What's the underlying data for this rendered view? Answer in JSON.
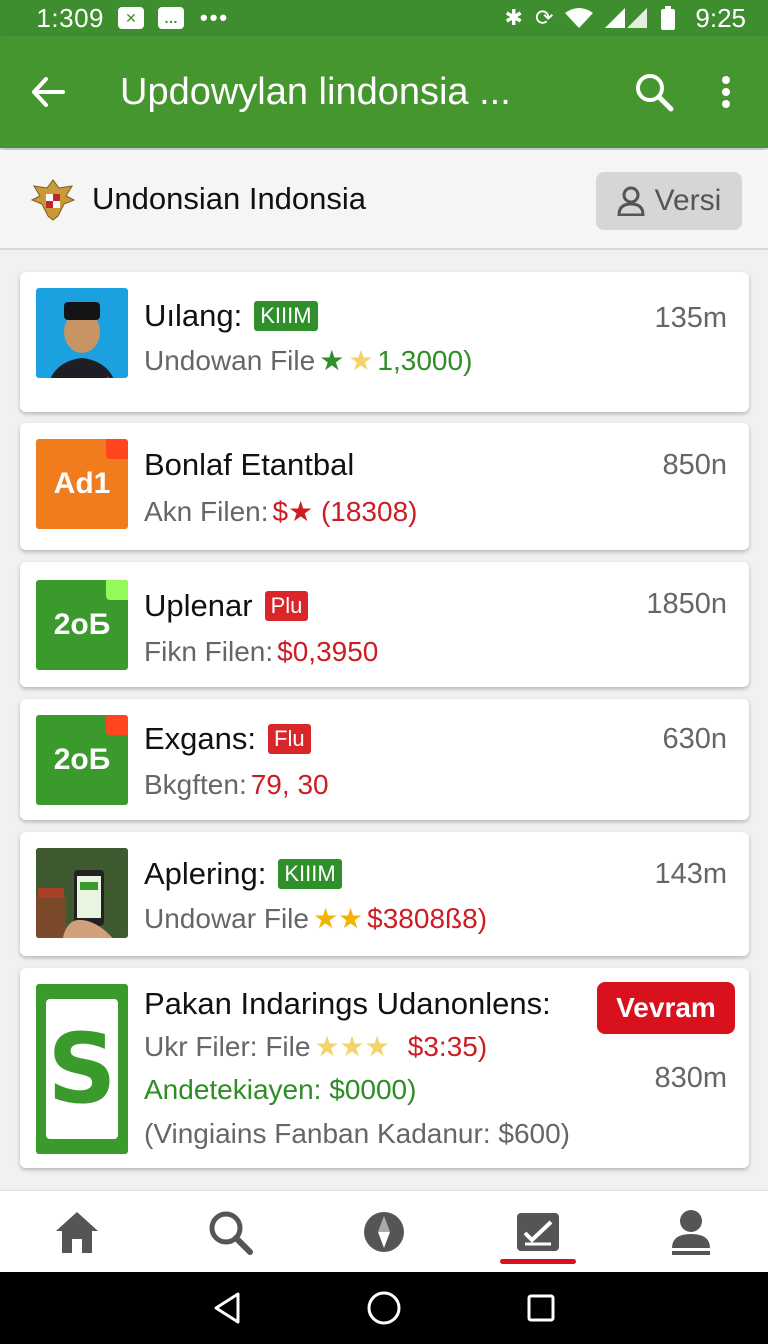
{
  "status_bar": {
    "time": "1:309",
    "clock": "9:25"
  },
  "app_bar": {
    "title": "Updowylan lindonsia ...",
    "back_icon": "arrow-left-icon",
    "search_icon": "search-icon",
    "more_icon": "more-vertical-icon"
  },
  "sub_header": {
    "title": "Undonsian Indonsia",
    "button_label": "Versi"
  },
  "items": [
    {
      "name": "Uılang:",
      "badge": "KIIIM",
      "detail_prefix": "Undowan File",
      "detail_value": "1,3000)",
      "size": "135m"
    },
    {
      "name": "Bonlaf Etantbal",
      "tile_text": "Ad1",
      "detail_prefix": "Akn Filen:",
      "detail_value": "$★ (18308)",
      "size": "850n"
    },
    {
      "name": "Uplenar",
      "badge": "Plu",
      "tile_text": "2oБ",
      "detail_prefix": "Fikn Filen:",
      "detail_value": "$0,3950",
      "size": "1850n"
    },
    {
      "name": "Exgans:",
      "badge": "Flu",
      "tile_text": "2oБ",
      "detail_prefix": "Bkgften:",
      "detail_value": "79, 30",
      "size": "630n"
    },
    {
      "name": "Aplering:",
      "badge": "KIIIM",
      "detail_prefix": "Undowar File",
      "detail_value": "$3808ß8)",
      "size": "143m"
    },
    {
      "name": "Pakan Indarings Udanonlens:",
      "tile_text": "S",
      "detail_prefix": "Ukr Filer: File",
      "detail_value": "$3:35)",
      "line2": "Andetekiayen: $0000)",
      "line3": "(Vingiains Fanban Kadanur: $600)",
      "button_label": "Vevram",
      "size": "830m"
    }
  ],
  "colors": {
    "primary": "#46962f",
    "accent": "#d8111c",
    "orange_tile": "#f07c1e",
    "green_tile": "#3a9a2c"
  }
}
